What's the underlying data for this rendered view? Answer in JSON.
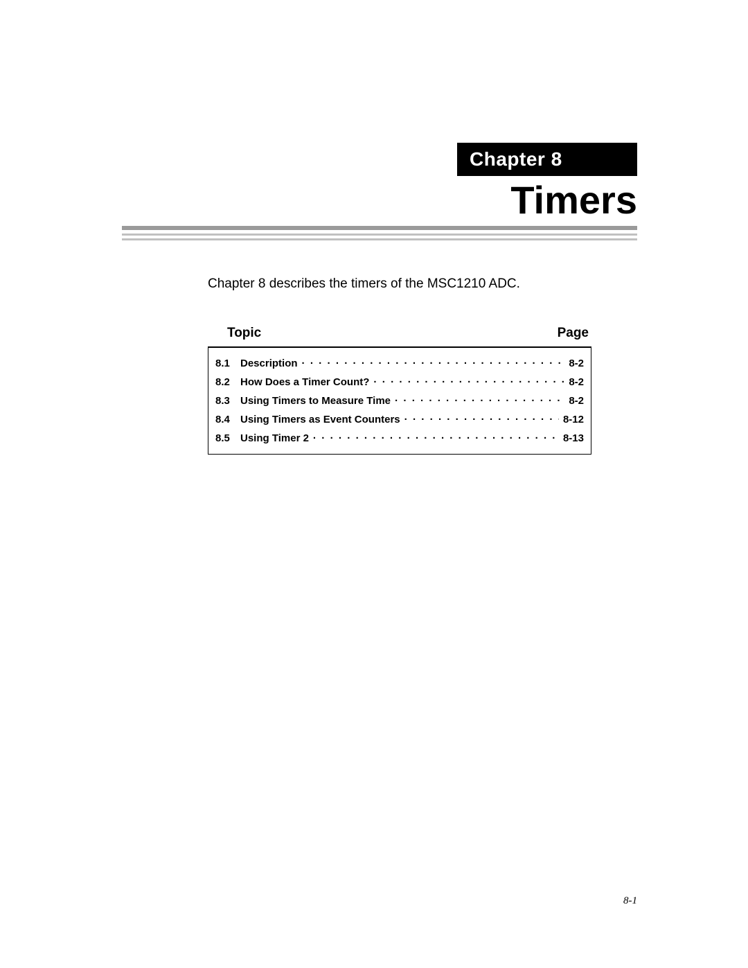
{
  "chapter_label": "Chapter 8",
  "title": "Timers",
  "intro": "Chapter 8 describes the timers of the MSC1210 ADC.",
  "toc": {
    "header_topic": "Topic",
    "header_page": "Page",
    "items": [
      {
        "num": "8.1",
        "title": "Description",
        "page": "8-2"
      },
      {
        "num": "8.2",
        "title": "How Does a Timer Count?",
        "page": "8-2"
      },
      {
        "num": "8.3",
        "title": "Using Timers to Measure Time",
        "page": "8-2"
      },
      {
        "num": "8.4",
        "title": "Using Timers as Event Counters",
        "page": "8-12"
      },
      {
        "num": "8.5",
        "title": "Using Timer 2",
        "page": "8-13"
      }
    ]
  },
  "footer_page": "8-1"
}
